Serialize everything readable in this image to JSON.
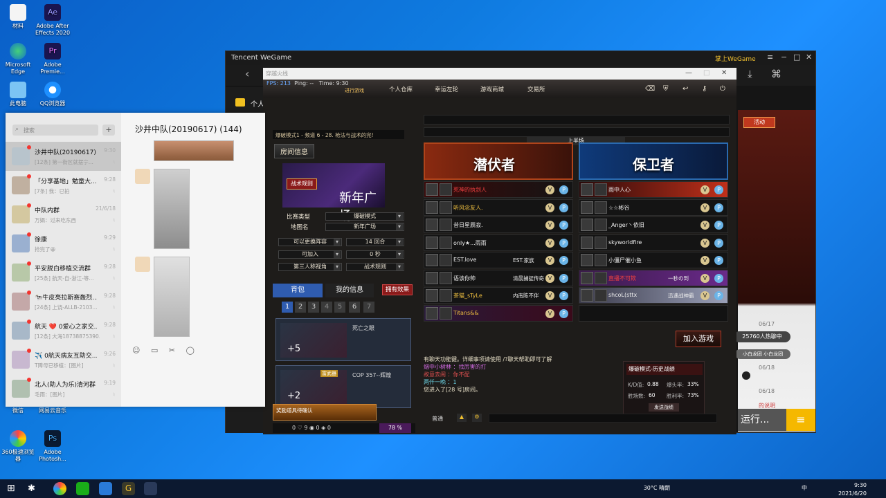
{
  "desktop": {
    "icons": [
      {
        "label": "材料"
      },
      {
        "label": "Adobe After Effects 2020"
      },
      {
        "label": "Microsoft Edge"
      },
      {
        "label": "Adobe Premie..."
      },
      {
        "label": "此电脑"
      },
      {
        "label": "QQ浏览器"
      },
      {
        "label": "微信"
      },
      {
        "label": "网易云音乐"
      },
      {
        "label": "360极速浏览器"
      },
      {
        "label": "Adobe Photosh..."
      }
    ]
  },
  "wechat": {
    "search_placeholder": "搜索",
    "plus": "+",
    "chat_title": "沙井中队(20190617) (144)",
    "conversations": [
      {
        "name": "沙井中队(20190617)",
        "preview": "[12条] 第一街区就摆宁...",
        "time": "9:30"
      },
      {
        "name": "「分享基地」勉童大...",
        "preview": "[7条] 我：已拍",
        "time": "9:28"
      },
      {
        "name": "中队内群",
        "preview": "万娟：过来吃东西",
        "time": "21/6/18"
      },
      {
        "name": "徐康",
        "preview": "抢完了😀",
        "time": "9:29"
      },
      {
        "name": "平安脱白移植交流群",
        "preview": "[25条] 航天-自-浙江-等...",
        "time": "9:28"
      },
      {
        "name": "🐄牛皮亮拉斯赛轰烈...",
        "preview": "[24条] 上饶-ALLB-2103...",
        "time": "9:28"
      },
      {
        "name": "航天 ❤️ 0爱心之家交...",
        "preview": "[12条] 大海18738875390...",
        "time": "9:28"
      },
      {
        "name": "✈️ 0航天病友互助交...",
        "preview": "T障母已移植：[图片]",
        "time": "9:26"
      },
      {
        "name": "北人(助人为乐)清河群",
        "preview": "毛雨：[图片]",
        "time": "9:19"
      }
    ],
    "toolbar": "☺ ▭ ✂ ◯"
  },
  "wegame": {
    "logo": "Tencent WeGame",
    "user": "掌上WeGame",
    "side_label": "个人",
    "right_badge": "活动",
    "right_time": "06/17",
    "right_time2": "06/18",
    "right_time3": "06/18",
    "popular": "25760人热聊中",
    "group_label": "小白龙团 小白龙团",
    "explain": "的说明",
    "run_label": "运行..."
  },
  "game": {
    "window_title": "穿越火线",
    "fps": "FPS: 213",
    "ping": "Ping: --",
    "time_label": "Time: 9:30",
    "menu": [
      "进行游戏",
      "个人仓库",
      "幸运左轮",
      "游戏商城",
      "交易所"
    ],
    "mode_line": "爆破模式1 - 频道 6 - 28. 枪法与战术的完!",
    "room_info": "房间信息",
    "banner_small": "战术规则",
    "banner_big": "新年广场",
    "match_type_label": "比赛类型",
    "match_type": "爆破模式",
    "map_label": "地图名",
    "map": "新年广场",
    "opt1": "可以更换阵容",
    "opt2": "14 回合",
    "opt3": "可加入",
    "opt4": "0 秒",
    "opt5": "第三人称视角",
    "opt6": "战术规则",
    "bag": "背包",
    "my_info": "我的信息",
    "effect": "拥有效果",
    "pages": [
      "1",
      "2",
      "3",
      "4",
      "5",
      "6",
      "7"
    ],
    "item1_name": "死亡之眼",
    "item1_count": "+5",
    "item2_name": "COP 357--辉煌",
    "item2_tag": "富武器",
    "item2_count": "+2",
    "reward": "奖励道具待确认",
    "foot_vals": "0  ♡  9  ◉  0  ◈  0",
    "xp": "78 %",
    "half": "上半场",
    "team_a": "潜伏者",
    "team_b": "保卫者",
    "rows_a": [
      "死神的执剑人",
      "听风念友人.",
      "昔日星辰寂.",
      "only★...雨雨",
      "EST.love",
      "语该你帅",
      "茶猫_sTyLe",
      "Titans&&"
    ],
    "rows_a_extra": [
      "",
      "",
      "",
      "",
      "EST.家族",
      "清晨捕捉传奇",
      "内南陈不伴",
      ""
    ],
    "rows_b": [
      "雨中人心",
      "☆☆彬谷",
      "_Anger丶依旧",
      "skyworldfire",
      "小僵尸催小鱼",
      "直播不可欺",
      "shcoL(sttx",
      ""
    ],
    "rows_b_extra": [
      "",
      "",
      "",
      "",
      "",
      "一秒の到",
      "迅速战神霸",
      ""
    ],
    "join": "加入游戏",
    "chat_lines": [
      {
        "text": "有聊天功能键。详细事项请使用 /?聊天帮助即可了解",
        "color": "#e8e0c8"
      },
      {
        "text": "烟中小树林 ：找厉害的打",
        "color": "#d06ae0"
      },
      {
        "text": "故意去闹 ：你不配",
        "color": "#e05050"
      },
      {
        "text": "两仟一晚 ：1",
        "color": "#6ad0e0"
      },
      {
        "text": "您进入了[28 号]房间。",
        "color": "#e8e0c8"
      }
    ],
    "hist_title": "爆破模式-历史战绩",
    "kd_label": "K/D值:",
    "kd": "0.88",
    "hs_label": "爆头率:",
    "hs": "33%",
    "wins_label": "胜场数:",
    "wins": "60",
    "wr_label": "胜利率:",
    "wr": "73%",
    "hist_btn": "发送战绩",
    "chat_mode": "普通"
  },
  "taskbar": {
    "weather": "30°C 晴朗",
    "ime": "中",
    "time": "9:30",
    "date": "2021/6/20"
  }
}
